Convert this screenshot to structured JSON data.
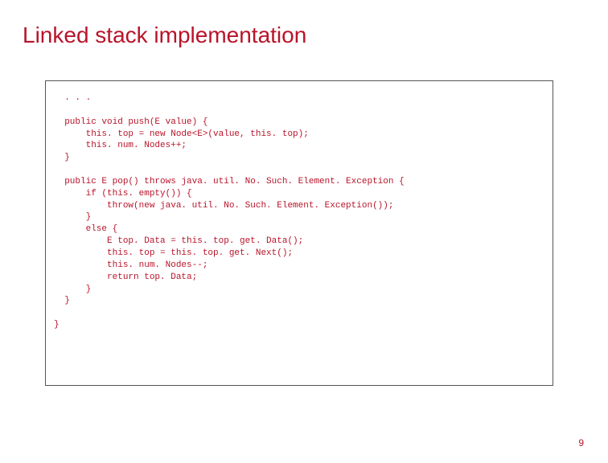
{
  "title": "Linked stack implementation",
  "code": "  . . .\n\n  public void push(E value) {\n      this. top = new Node<E>(value, this. top);\n      this. num. Nodes++;\n  }\n\n  public E pop() throws java. util. No. Such. Element. Exception {\n      if (this. empty()) {\n          throw(new java. util. No. Such. Element. Exception());\n      }\n      else {\n          E top. Data = this. top. get. Data();\n          this. top = this. top. get. Next();\n          this. num. Nodes--;\n          return top. Data;\n      }\n  }\n\n}",
  "page_number": "9"
}
